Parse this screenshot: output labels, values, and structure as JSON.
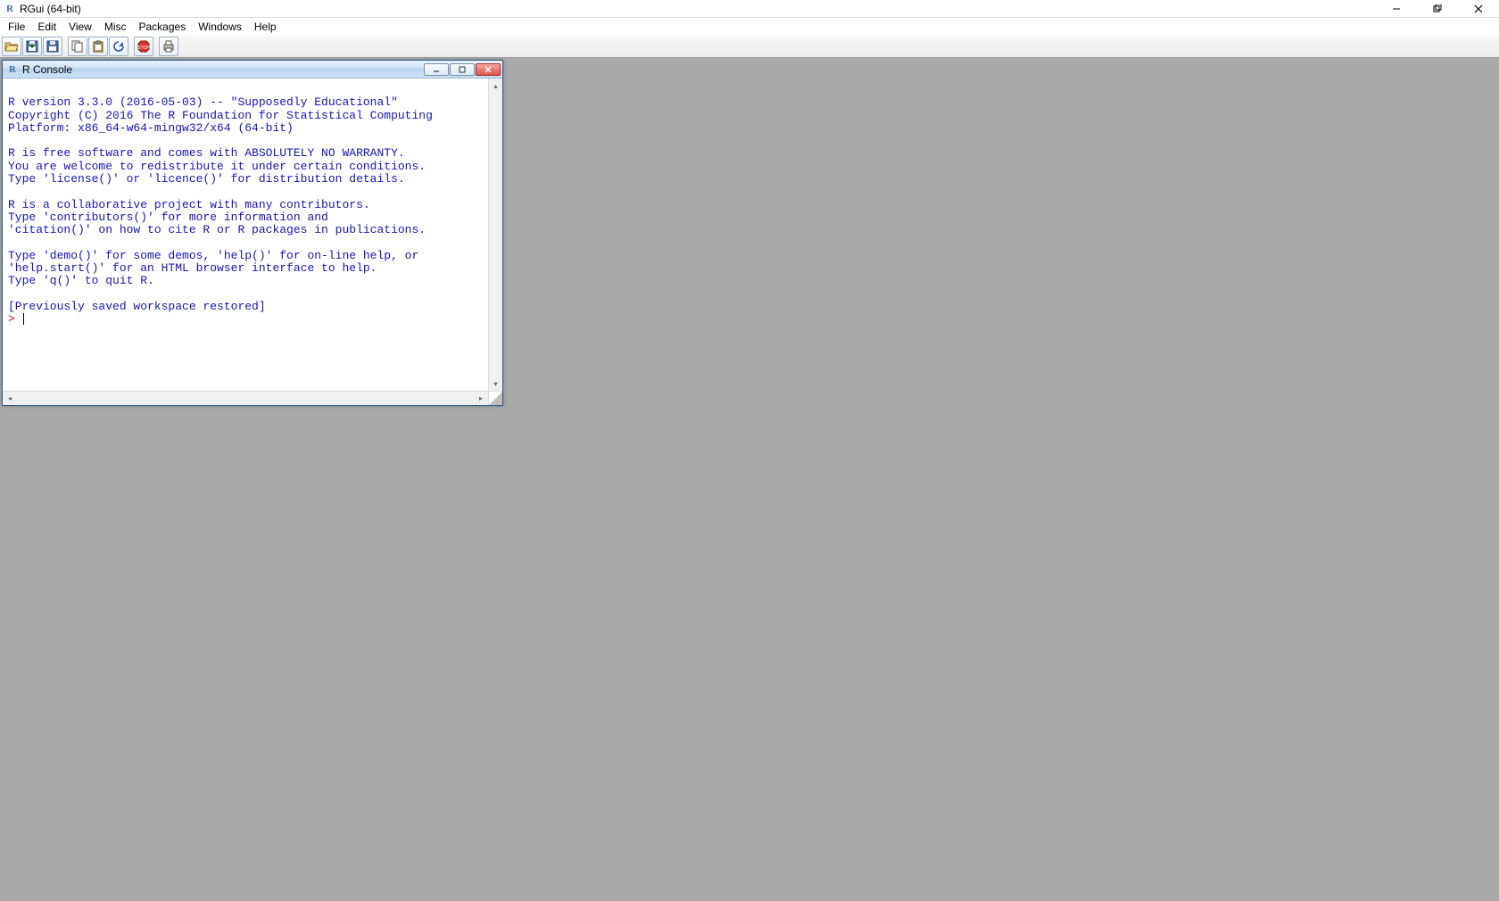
{
  "app": {
    "title": "RGui (64-bit)"
  },
  "menu": {
    "items": [
      "File",
      "Edit",
      "View",
      "Misc",
      "Packages",
      "Windows",
      "Help"
    ]
  },
  "toolbar": {
    "buttons": [
      {
        "name": "open-script-button",
        "icon": "open-folder-icon"
      },
      {
        "name": "load-workspace-button",
        "icon": "floppy-in-icon"
      },
      {
        "name": "save-workspace-button",
        "icon": "floppy-icon"
      },
      {
        "sep": true
      },
      {
        "name": "copy-button",
        "icon": "copy-icon"
      },
      {
        "name": "paste-button",
        "icon": "paste-icon"
      },
      {
        "name": "copy-paste-button",
        "icon": "refresh-icon"
      },
      {
        "sep": true
      },
      {
        "name": "stop-button",
        "icon": "stop-icon"
      },
      {
        "sep": true
      },
      {
        "name": "print-button",
        "icon": "printer-icon"
      }
    ]
  },
  "console": {
    "title": "R Console",
    "output": "\nR version 3.3.0 (2016-05-03) -- \"Supposedly Educational\"\nCopyright (C) 2016 The R Foundation for Statistical Computing\nPlatform: x86_64-w64-mingw32/x64 (64-bit)\n\nR is free software and comes with ABSOLUTELY NO WARRANTY.\nYou are welcome to redistribute it under certain conditions.\nType 'license()' or 'licence()' for distribution details.\n\nR is a collaborative project with many contributors.\nType 'contributors()' for more information and\n'citation()' on how to cite R or R packages in publications.\n\nType 'demo()' for some demos, 'help()' for on-line help, or\n'help.start()' for an HTML browser interface to help.\nType 'q()' to quit R.\n\n[Previously saved workspace restored]\n",
    "prompt": "> "
  }
}
